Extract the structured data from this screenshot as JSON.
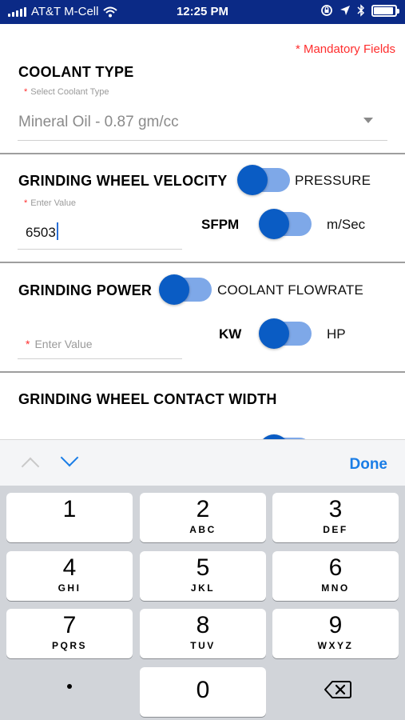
{
  "status_bar": {
    "carrier": "AT&T M-Cell",
    "time": "12:25 PM",
    "battery_level": 0.85
  },
  "form": {
    "mandatory_note": "* Mandatory Fields",
    "coolant": {
      "title": "COOLANT TYPE",
      "hint": "Select Coolant Type",
      "value": "Mineral Oil - 0.87 gm/cc"
    },
    "wheel_velocity": {
      "title": "GRINDING WHEEL VELOCITY",
      "toggle_label": "PRESSURE",
      "hint": "Enter Value",
      "value": "6503",
      "unit_left": "SFPM",
      "unit_right": "m/Sec"
    },
    "grinding_power": {
      "title": "GRINDING POWER",
      "toggle_label": "COOLANT FLOWRATE",
      "placeholder": "Enter Value",
      "unit_left": "KW",
      "unit_right": "HP"
    },
    "contact_width": {
      "title": "GRINDING WHEEL CONTACT WIDTH"
    }
  },
  "accessory": {
    "done_label": "Done"
  },
  "keypad": {
    "keys": [
      {
        "num": "1",
        "letters": ""
      },
      {
        "num": "2",
        "letters": "ABC"
      },
      {
        "num": "3",
        "letters": "DEF"
      },
      {
        "num": "4",
        "letters": "GHI"
      },
      {
        "num": "5",
        "letters": "JKL"
      },
      {
        "num": "6",
        "letters": "MNO"
      },
      {
        "num": "7",
        "letters": "PQRS"
      },
      {
        "num": "8",
        "letters": "TUV"
      },
      {
        "num": "9",
        "letters": "WXYZ"
      },
      {
        "num": "0",
        "letters": ""
      }
    ]
  },
  "colors": {
    "status_bar_bg": "#0b2a86",
    "accent_blue": "#1a7de6",
    "mandatory_red": "#ff2d2d",
    "toggle_knob": "#0a5cc4",
    "toggle_track": "#7ea8e8"
  }
}
